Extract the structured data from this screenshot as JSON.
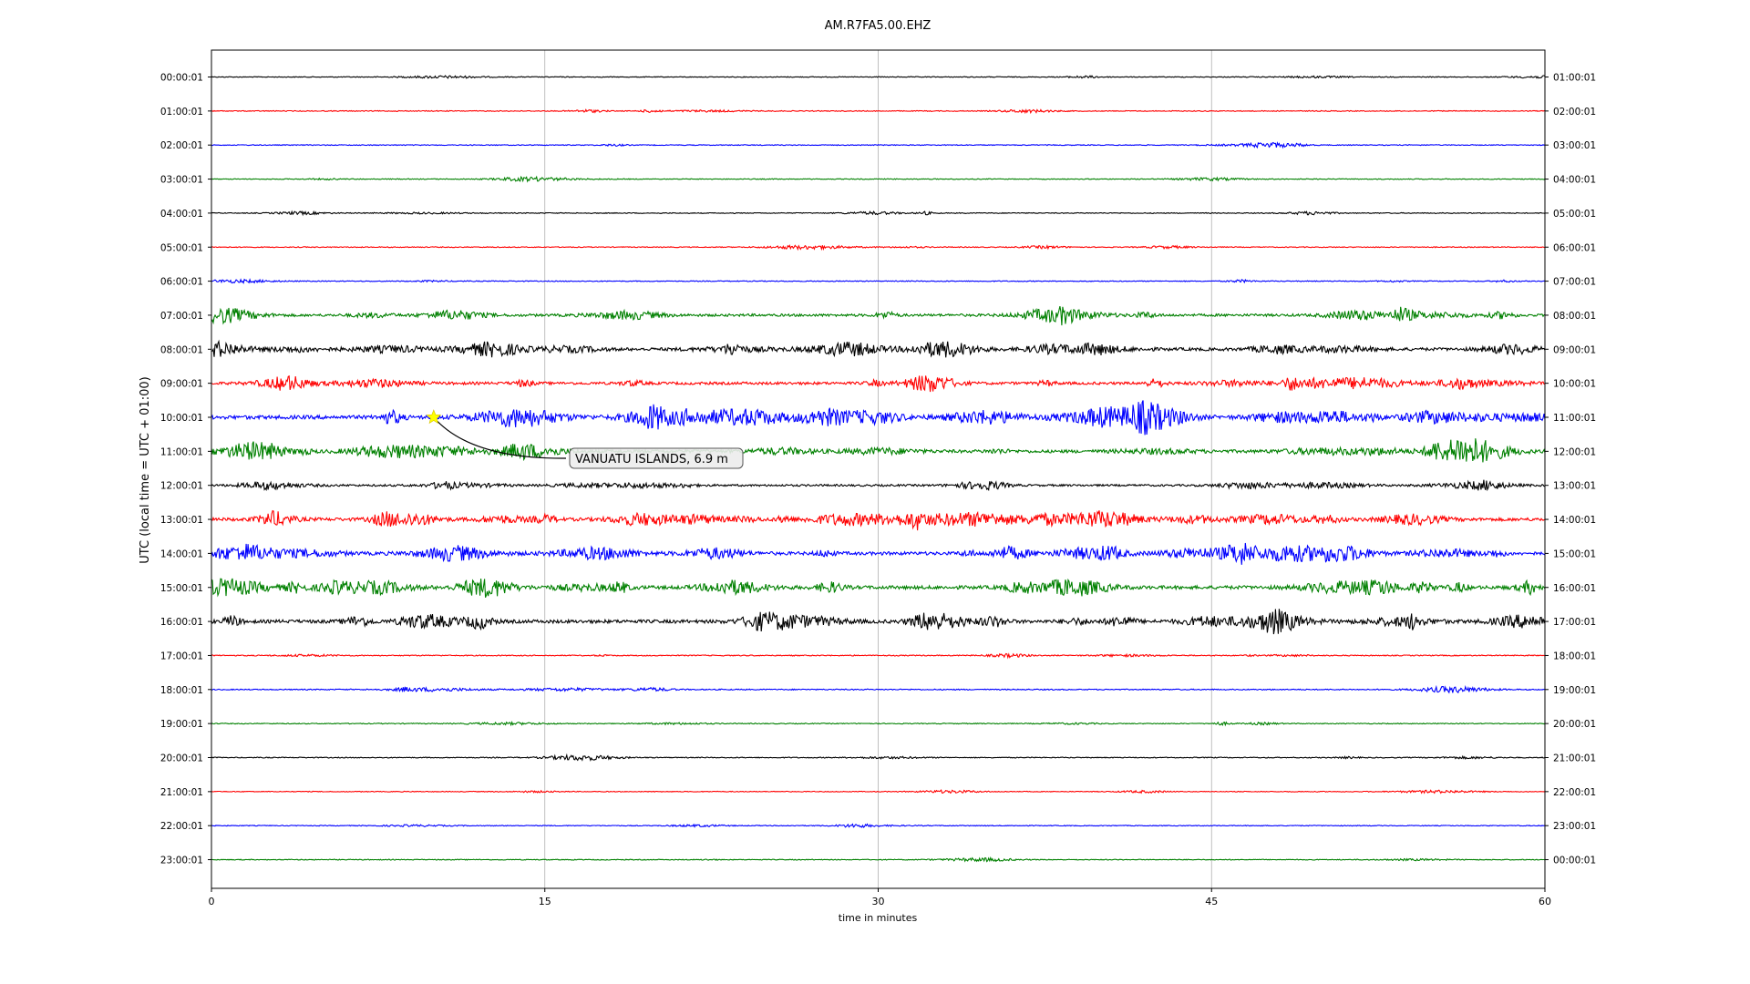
{
  "chart_data": {
    "type": "line",
    "title": "AM.R7FA5.00.EHZ",
    "xlabel": "time in minutes",
    "ylabel": "UTC (local time = UTC + 01:00)",
    "xlim": [
      0,
      60
    ],
    "xticks": [
      "0",
      "15",
      "30",
      "45",
      "60"
    ],
    "xtick_values": [
      0,
      15,
      30,
      45,
      60
    ],
    "grid": "vertical at 15, 30, 45",
    "trace_colors": [
      "#000000",
      "#ff0000",
      "#0000ff",
      "#008000"
    ],
    "left_labels": [
      "00:00:01",
      "01:00:01",
      "02:00:01",
      "03:00:01",
      "04:00:01",
      "05:00:01",
      "06:00:01",
      "07:00:01",
      "08:00:01",
      "09:00:01",
      "10:00:01",
      "11:00:01",
      "12:00:01",
      "13:00:01",
      "14:00:01",
      "15:00:01",
      "16:00:01",
      "17:00:01",
      "18:00:01",
      "19:00:01",
      "20:00:01",
      "21:00:01",
      "22:00:01",
      "23:00:01"
    ],
    "right_labels": [
      "01:00:01",
      "02:00:01",
      "03:00:01",
      "04:00:01",
      "05:00:01",
      "06:00:01",
      "07:00:01",
      "08:00:01",
      "09:00:01",
      "10:00:01",
      "11:00:01",
      "12:00:01",
      "13:00:01",
      "14:00:01",
      "15:00:01",
      "16:00:01",
      "17:00:01",
      "18:00:01",
      "19:00:01",
      "20:00:01",
      "21:00:01",
      "22:00:01",
      "23:00:01",
      "00:00:01"
    ],
    "trace_activity": [
      0.15,
      0.2,
      0.2,
      0.15,
      0.2,
      0.2,
      0.2,
      1.1,
      1.4,
      1.2,
      1.8,
      1.4,
      0.8,
      1.5,
      1.5,
      1.6,
      1.6,
      0.25,
      0.3,
      0.2,
      0.2,
      0.15,
      0.15,
      0.15
    ],
    "event": {
      "label": "VANUATU ISLANDS, 6.9 m",
      "minute": 10.0,
      "trace_index": 10,
      "marker_color": "#ffff00"
    }
  }
}
